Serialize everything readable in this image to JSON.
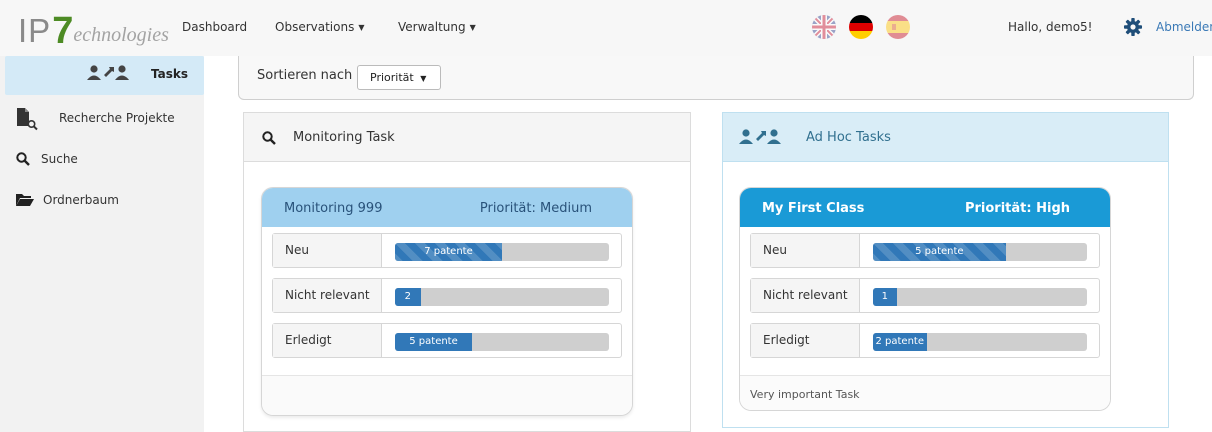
{
  "brand": {
    "logo_ip": "IP",
    "logo_seven": "7",
    "logo_rest": "echnologies"
  },
  "nav": {
    "items": [
      {
        "label": "Dashboard",
        "has_caret": false
      },
      {
        "label": "Observations",
        "has_caret": true
      },
      {
        "label": "Verwaltung",
        "has_caret": true
      }
    ],
    "caret": "▼",
    "languages": [
      {
        "icon": "uk-flag-icon",
        "active": false
      },
      {
        "icon": "germany-flag-icon",
        "active": true
      },
      {
        "icon": "spain-flag-icon",
        "active": false
      }
    ],
    "greeting": "Hallo, demo5!",
    "settings_icon": "gear-icon",
    "logout_label": "Abmelden"
  },
  "sidebar": {
    "items": [
      {
        "label": "Tasks",
        "icon": "users-icon",
        "active": true
      },
      {
        "label": "Recherche Projekte",
        "icon": "file-search-icon",
        "active": false
      },
      {
        "label": "Suche",
        "icon": "search-icon",
        "active": false
      },
      {
        "label": "Ordnerbaum",
        "icon": "folder-open-icon",
        "active": false
      }
    ]
  },
  "sort": {
    "label": "Sortieren nach",
    "value": "Priorität"
  },
  "panels": [
    {
      "title": "Monitoring Task",
      "icon": "search-icon",
      "card": {
        "name": "Monitoring 999",
        "priority": "Priorität: Medium",
        "rows": [
          {
            "label": "Neu",
            "bar_text": "7 patente",
            "fraction": 0.5,
            "striped": true
          },
          {
            "label": "Nicht relevant",
            "bar_text": "2",
            "fraction": 0.12,
            "striped": false
          },
          {
            "label": "Erledigt",
            "bar_text": "5 patente",
            "fraction": 0.36,
            "striped": false
          }
        ],
        "note": ""
      }
    },
    {
      "title": "Ad Hoc Tasks",
      "icon": "users-icon",
      "card": {
        "name": "My First Class",
        "priority": "Priorität: High",
        "rows": [
          {
            "label": "Neu",
            "bar_text": "5 patente",
            "fraction": 0.62,
            "striped": true
          },
          {
            "label": "Nicht relevant",
            "bar_text": "1",
            "fraction": 0.11,
            "striped": false
          },
          {
            "label": "Erledigt",
            "bar_text": "2 patente",
            "fraction": 0.25,
            "striped": false
          }
        ],
        "note": "Very important Task"
      }
    }
  ],
  "colors": {
    "accent": "#1a9ad6",
    "accent_light": "#9fd0ef",
    "bar_fill": "#3178b8",
    "panel_head_blue": "#d9edf7",
    "logo_green": "#4d8b24",
    "link": "#3a79b6"
  }
}
